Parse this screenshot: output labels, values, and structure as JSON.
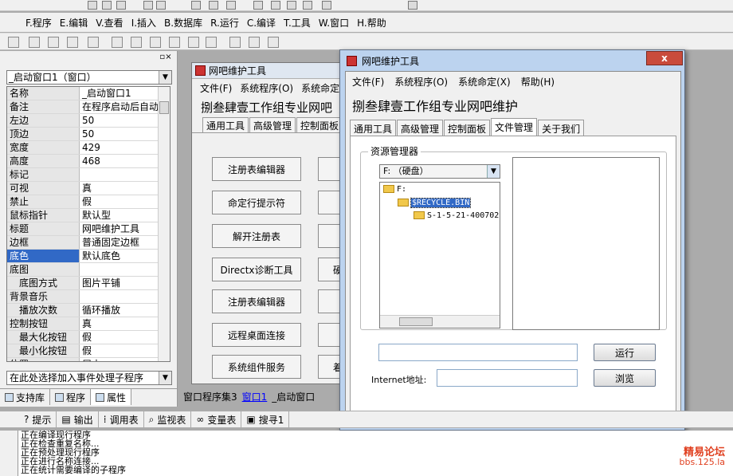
{
  "main_menu": [
    "F.程序",
    "E.编辑",
    "V.查看",
    "I.插入",
    "B.数据库",
    "R.运行",
    "C.编译",
    "T.工具",
    "W.窗口",
    "H.帮助"
  ],
  "property_panel": {
    "object_combo": "_启动窗口1（窗口）",
    "rows": [
      {
        "name": "名称",
        "value": "_启动窗口1",
        "sub": false
      },
      {
        "name": "备注",
        "value": "在程序启动后自动",
        "sub": false
      },
      {
        "name": "左边",
        "value": "50",
        "sub": false
      },
      {
        "name": "顶边",
        "value": "50",
        "sub": false
      },
      {
        "name": "宽度",
        "value": "429",
        "sub": false
      },
      {
        "name": "高度",
        "value": "468",
        "sub": false
      },
      {
        "name": "标记",
        "value": "",
        "sub": false
      },
      {
        "name": "可视",
        "value": "真",
        "sub": false
      },
      {
        "name": "禁止",
        "value": "假",
        "sub": false
      },
      {
        "name": "鼠标指针",
        "value": "默认型",
        "sub": false
      },
      {
        "name": "标题",
        "value": "网吧维护工具",
        "sub": false
      },
      {
        "name": "边框",
        "value": "普通固定边框",
        "sub": false
      },
      {
        "name": "底色",
        "value": "默认底色",
        "sub": false,
        "selected": true
      },
      {
        "name": "底图",
        "value": "",
        "sub": false
      },
      {
        "name": "底图方式",
        "value": "图片平铺",
        "sub": true
      },
      {
        "name": "背景音乐",
        "value": "",
        "sub": false
      },
      {
        "name": "播放次数",
        "value": "循环播放",
        "sub": true
      },
      {
        "name": "控制按钮",
        "value": "真",
        "sub": false
      },
      {
        "name": "最大化按钮",
        "value": "假",
        "sub": true
      },
      {
        "name": "最小化按钮",
        "value": "假",
        "sub": true
      },
      {
        "name": "位置",
        "value": "居中",
        "sub": false
      }
    ],
    "event_combo": "在此处选择加入事件处理子程序",
    "tabs": [
      "支持库",
      "程序",
      "属性"
    ]
  },
  "designer": {
    "title": "网吧维护工具",
    "menu": [
      "文件(F)",
      "系统程序(O)",
      "系统命定"
    ],
    "heading": "捌叁肆壹工作组专业网吧",
    "tabs": [
      "通用工具",
      "高级管理",
      "控制面板"
    ],
    "buttons": [
      "注册表编辑器",
      "命定行提示符",
      "解开注册表",
      "Directx诊断工具",
      "注册表编辑器",
      "远程桌面连接",
      "系统组件服务"
    ],
    "right_buttons": [
      "",
      "",
      "",
      "硬",
      "",
      "",
      "着"
    ]
  },
  "center_tabs": [
    "窗口程序集3",
    "窗口1",
    "_启动窗口"
  ],
  "dialog": {
    "title": "网吧维护工具",
    "close": "x",
    "menu": [
      "文件(F)",
      "系统程序(O)",
      "系统命定(X)",
      "帮助(H)"
    ],
    "heading": "捌叁肆壹工作组专业网吧维护",
    "tabs": [
      "通用工具",
      "高级管理",
      "控制面板",
      "文件管理",
      "关于我们"
    ],
    "active_tab": "文件管理",
    "group_label": "资源管理器",
    "drive": "F: （硬盘）",
    "tree": [
      "F:",
      "$RECYCLE.BIN",
      "S-1-5-21-400702"
    ],
    "run_button": "运行",
    "internet_label": "Internet地址:",
    "browse_button": "浏览"
  },
  "output_tabs": [
    "提示",
    "输出",
    "调用表",
    "监视表",
    "变量表",
    "搜寻1"
  ],
  "output_lines": [
    "正在编译现行程序",
    "正在检查重复名称...",
    "正在预处理现行程序",
    "正在进行名称连接...",
    "正在统计需要编译的子程序"
  ],
  "watermark": {
    "name": "精易论坛",
    "url": "bbs.125.la"
  }
}
